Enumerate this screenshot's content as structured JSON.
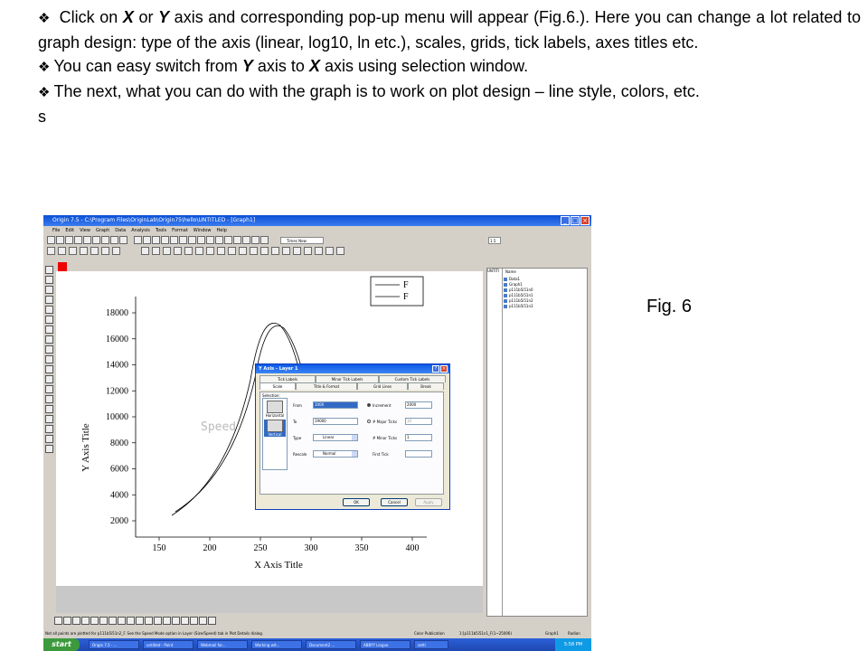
{
  "bullets": [
    {
      "parts": [
        {
          "t": "Click on "
        },
        {
          "t": "X",
          "b": true
        },
        {
          "t": " or "
        },
        {
          "t": "Y",
          "b": true
        },
        {
          "t": " axis and corresponding pop-up menu will appear (Fig.6.). Here you can change a lot related to graph design: type of the axis (linear, log10, ln etc.), scales, grids, tick labels, axes titles etc."
        }
      ]
    },
    {
      "parts": [
        {
          "t": "You can easy switch from "
        },
        {
          "t": "Y",
          "b": true
        },
        {
          "t": " axis to "
        },
        {
          "t": "X",
          "b": true
        },
        {
          "t": " axis using selection window."
        }
      ]
    },
    {
      "parts": [
        {
          "t": "The next, what you can do with the graph is to work on plot design – line style, colors, etc."
        }
      ]
    }
  ],
  "trailing_text": "s",
  "figure_label": "Fig. 6",
  "app": {
    "window_title": "Origin 7.5 - C:\\Program Files\\OriginLab\\Origin75\\hello\\UNTITLED - [Graph1]",
    "menu": [
      "File",
      "Edit",
      "View",
      "Graph",
      "Data",
      "Analysis",
      "Tools",
      "Format",
      "Window",
      "Help"
    ],
    "font_box": "Times New",
    "line_width": "1.5"
  },
  "graph": {
    "legend": [
      "F",
      "F"
    ],
    "ylabel": "Y Axis Title",
    "xlabel": "X Axis Title",
    "watermark": "Speed",
    "yticks": [
      "18000",
      "16000",
      "14000",
      "12000",
      "10000",
      "8000",
      "6000",
      "4000",
      "2000"
    ],
    "xticks": [
      "150",
      "200",
      "250",
      "300",
      "350",
      "400"
    ]
  },
  "explorer": {
    "tree_root": "UNTITI",
    "column_header": "Name",
    "items": [
      "Data1",
      "Graph1",
      "p111b5i51n0",
      "p111b5i51n1",
      "p111b5i51n2",
      "p111b5i51n3"
    ]
  },
  "dialog": {
    "title": "Y Axis - Layer 1",
    "tabs_row1": [
      "Tick Labels",
      "Minor Tick Labels",
      "Custom Tick Labels"
    ],
    "tabs_row2": [
      "Scale",
      "Title & Format",
      "Grid Lines",
      "Break"
    ],
    "selection_label": "Selection:",
    "selection_items": [
      "Horizontal",
      "Vertical"
    ],
    "from_label": "From",
    "from_value": "1000",
    "to_label": "To",
    "to_value": "19000",
    "type_label": "Type",
    "type_value": "Linear",
    "rescale_label": "Rescale",
    "rescale_value": "Normal",
    "increment_label": "Increment",
    "increment_value": "2000",
    "major_ticks_label": "# Major Ticks",
    "major_ticks_value": "10",
    "minor_ticks_label": "# Minor Ticks",
    "minor_ticks_value": "1",
    "first_tick_label": "First Tick",
    "first_tick_value": "",
    "ok": "OK",
    "cancel": "Cancel",
    "apply": "Apply"
  },
  "status": {
    "hint": "Not all points are plotted for p111b5i51n2_F. See the Speed Mode option in Layer (Size/Speed) tab in Plot Details dialog.",
    "color_mode": "Color Publication",
    "cell": "1:[p111b5i51n1_F(1~25006)",
    "window": "Graph1",
    "angle": "Radian"
  },
  "taskbar": {
    "start": "start",
    "items": [
      "Origin 7.5 - ...",
      "untitled - Paint",
      "Webmail for...",
      "Working wit...",
      "Document2 ...",
      "ABBYY Lingvo",
      "setti"
    ],
    "clock": "5:58 PM"
  }
}
